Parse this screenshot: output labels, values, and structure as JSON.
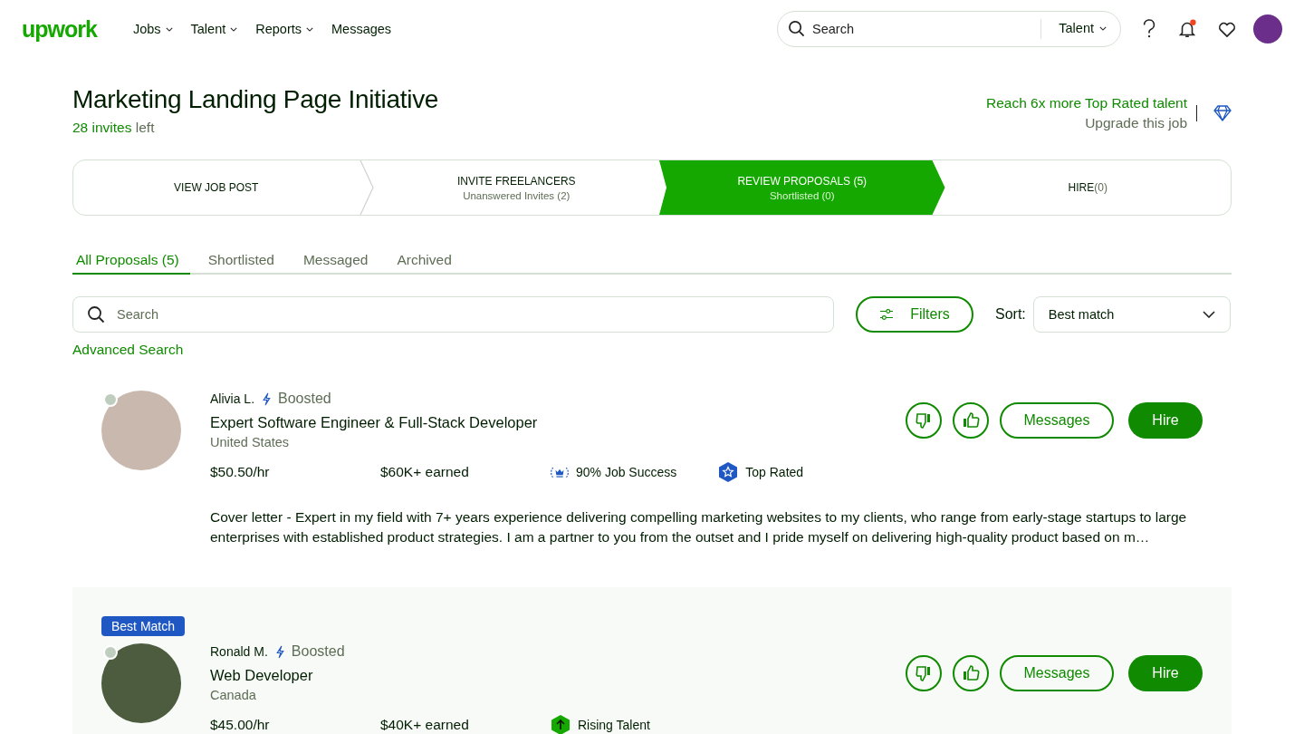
{
  "nav": {
    "logo": "upwork",
    "menu": [
      {
        "label": "Jobs",
        "dropdown": true
      },
      {
        "label": "Talent",
        "dropdown": true
      },
      {
        "label": "Reports",
        "dropdown": true
      },
      {
        "label": "Messages",
        "dropdown": false
      }
    ],
    "search": {
      "placeholder": "Search",
      "scope": "Talent"
    },
    "notifications_unread": true
  },
  "job": {
    "title": "Marketing Landing Page Initiative",
    "invites_count": "28 invites",
    "invites_suffix": "left",
    "upgrade_link": "Reach 6x more Top Rated talent",
    "upgrade_text": "Upgrade this job"
  },
  "steps": [
    {
      "title": "VIEW JOB POST",
      "selected": false
    },
    {
      "title": "INVITE FREELANCERS",
      "subtitle": "Unanswered Invites (2)",
      "selected": false
    },
    {
      "title": "REVIEW PROPOSALS (5)",
      "subtitle": "Shortlisted (0)",
      "selected": true
    },
    {
      "title": "HIRE",
      "count": "(0)",
      "selected": false
    }
  ],
  "tabs": [
    {
      "label": "All Proposals (5)",
      "selected": true
    },
    {
      "label": "Shortlisted",
      "selected": false
    },
    {
      "label": "Messaged",
      "selected": false
    },
    {
      "label": "Archived",
      "selected": false
    }
  ],
  "filter_bar": {
    "search_placeholder": "Search",
    "filters_button": "Filters",
    "sort_label": "Sort:",
    "sort_value": "Best match",
    "advanced_search": "Advanced Search"
  },
  "proposals": [
    {
      "name": "Alivia L.",
      "boosted": "Boosted",
      "title": "Expert Software Engineer & Full-Stack Developer",
      "location": "United States",
      "rate": "$50.50/hr",
      "earned": "$60K+ earned",
      "highlighted": false,
      "badges": [
        {
          "kind": "job_success",
          "label": "90% Job Success"
        },
        {
          "kind": "top_rated",
          "label": "Top Rated"
        }
      ],
      "cover_letter": "Cover letter - Expert in my field with 7+ years experience delivering compelling marketing websites to my clients, who range from early-stage startups to large enterprises with established product strategies. I am a partner to you from the outset and I pride myself on delivering high-quality product based on m…",
      "actions": {
        "messages": "Messages",
        "hire": "Hire"
      }
    },
    {
      "name": "Ronald M.",
      "tag": "Best Match",
      "boosted": "Boosted",
      "title": "Web Developer",
      "location": "Canada",
      "rate": "$45.00/hr",
      "earned": "$40K+ earned",
      "highlighted": true,
      "badges": [
        {
          "kind": "rising_talent",
          "label": "Rising Talent"
        }
      ],
      "actions": {
        "messages": "Messages",
        "hire": "Hire"
      }
    }
  ]
}
